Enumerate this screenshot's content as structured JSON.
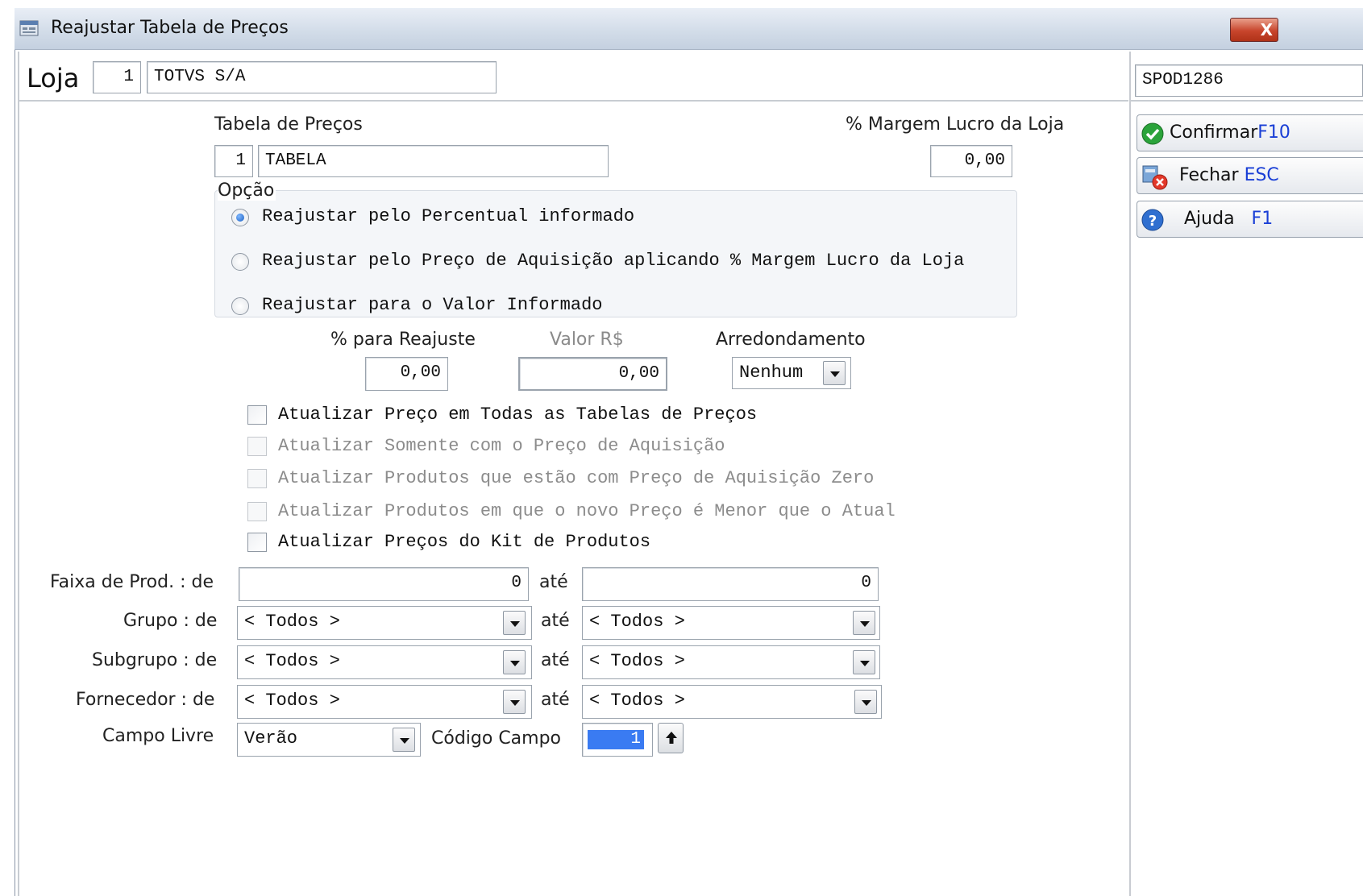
{
  "window": {
    "title": "Reajustar Tabela de Preços",
    "close_label": "X"
  },
  "loja": {
    "label": "Loja",
    "code": "1",
    "name": "TOTVS S/A"
  },
  "session": {
    "user_code": "SPOD1286"
  },
  "tabela": {
    "label": "Tabela de Preços",
    "code": "1",
    "name": "TABELA"
  },
  "margem": {
    "label": "% Margem Lucro da Loja",
    "value": "0,00"
  },
  "opcao": {
    "legend": "Opção",
    "options": [
      {
        "label": "Reajustar pelo Percentual informado",
        "selected": true
      },
      {
        "label": "Reajustar pelo Preço de Aquisição aplicando % Margem Lucro da Loja",
        "selected": false
      },
      {
        "label": "Reajustar para o Valor Informado",
        "selected": false
      }
    ]
  },
  "reajuste": {
    "percent_label": "% para Reajuste",
    "percent_value": "0,00",
    "valor_label": "Valor R$",
    "valor_value": "0,00",
    "arred_label": "Arredondamento",
    "arred_value": "Nenhum"
  },
  "checks": [
    {
      "label": "Atualizar Preço em Todas as Tabelas de Preços",
      "enabled": true,
      "checked": false
    },
    {
      "label": "Atualizar Somente com o Preço de Aquisição",
      "enabled": false,
      "checked": false
    },
    {
      "label": "Atualizar Produtos que estão com Preço de Aquisição Zero",
      "enabled": false,
      "checked": false
    },
    {
      "label": "Atualizar Produtos em que o novo Preço é Menor que o Atual",
      "enabled": false,
      "checked": false
    },
    {
      "label": "Atualizar Preços do Kit de Produtos",
      "enabled": true,
      "checked": false
    }
  ],
  "filters": {
    "ate_label": "até",
    "faixa": {
      "label": "Faixa de Prod. : de",
      "from": "0",
      "to": "0"
    },
    "grupo": {
      "label": "Grupo : de",
      "from": "< Todos >",
      "to": "< Todos >"
    },
    "subgrupo": {
      "label": "Subgrupo : de",
      "from": "< Todos >",
      "to": "< Todos >"
    },
    "fornecedor": {
      "label": "Fornecedor : de",
      "from": "< Todos >",
      "to": "< Todos >"
    },
    "campo_livre": {
      "label": "Campo Livre",
      "value": "Verão"
    },
    "codigo_campo": {
      "label": "Código Campo",
      "value": "1"
    }
  },
  "buttons": {
    "confirmar": {
      "label": "Confirmar",
      "key": "F10"
    },
    "fechar": {
      "label": "Fechar",
      "key": "ESC"
    },
    "ajuda": {
      "label": "Ajuda",
      "key": "F1"
    }
  },
  "colors": {
    "title_bar": "#d3dde9",
    "accent_blue": "#1a3fd6",
    "close_red": "#c8452c",
    "selection_blue": "#3a7bf2"
  }
}
